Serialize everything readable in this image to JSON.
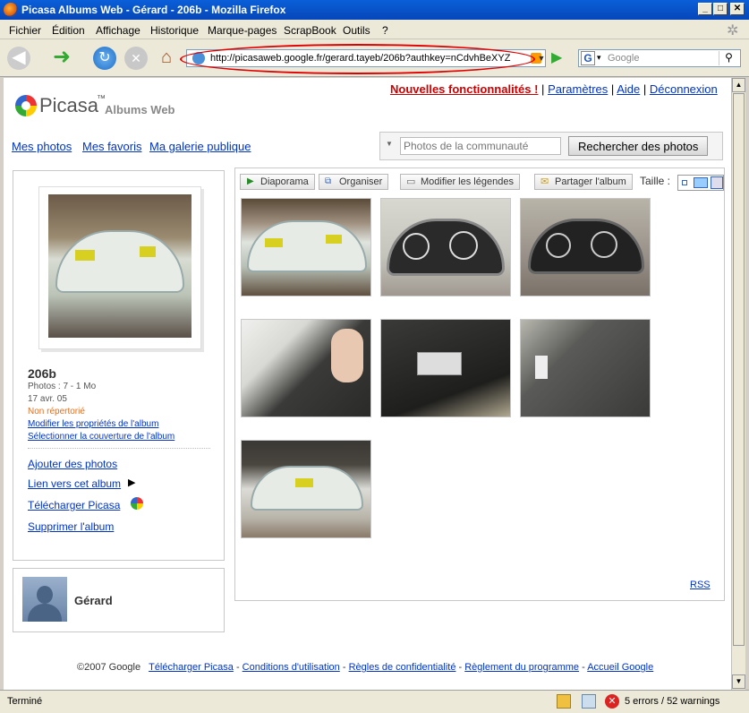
{
  "window": {
    "title": "Picasa Albums Web - Gérard - 206b - Mozilla Firefox"
  },
  "menu": [
    "Fichier",
    "Édition",
    "Affichage",
    "Historique",
    "Marque-pages",
    "ScrapBook",
    "Outils",
    "?"
  ],
  "urlbar": {
    "url": "http://picasaweb.google.fr/gerard.tayeb/206b?authkey=nCdvhBeXYZ"
  },
  "search": {
    "placeholder": "Google"
  },
  "header": {
    "logo": "Picasa",
    "logo_tm": "™",
    "logo_sub": "Albums Web",
    "links": {
      "new": "Nouvelles fonctionnalités !",
      "settings": "Paramètres",
      "help": "Aide",
      "logout": "Déconnexion"
    },
    "sep": "|"
  },
  "nav": {
    "my_photos": "Mes photos",
    "favorites": "Mes favoris",
    "public_gallery": "Ma galerie publique"
  },
  "community": {
    "placeholder": "Photos de la communauté",
    "button": "Rechercher des photos"
  },
  "album": {
    "title": "206b",
    "photos": "Photos : 7 - 1 Mo",
    "date": "17 avr. 05",
    "visibility": "Non répertorié",
    "edit_props": "Modifier les propriétés de l'album",
    "select_cover": "Sélectionner la couverture de l'album",
    "add_photos": "Ajouter des photos",
    "link": "Lien vers cet album",
    "download": "Télécharger Picasa",
    "delete": "Supprimer l'album"
  },
  "owner": {
    "name": "Gérard"
  },
  "toolbar": {
    "slideshow": "Diaporama",
    "organize": "Organiser",
    "captions": "Modifier les légendes",
    "share": "Partager l'album",
    "size": "Taille :"
  },
  "rss": "RSS",
  "footer": {
    "copyright": "©2007 Google",
    "links": [
      "Télécharger Picasa",
      "Conditions d'utilisation",
      "Règles de confidentialité",
      "Règlement du programme",
      "Accueil Google"
    ],
    "sep": "-"
  },
  "status": {
    "text": "Terminé",
    "errors": "5 errors / 52 warnings"
  },
  "colors": {
    "link": "#0033cc",
    "new_link": "#cc0000",
    "visibility": "#e07020",
    "titlebar": "#0a5fd8"
  }
}
